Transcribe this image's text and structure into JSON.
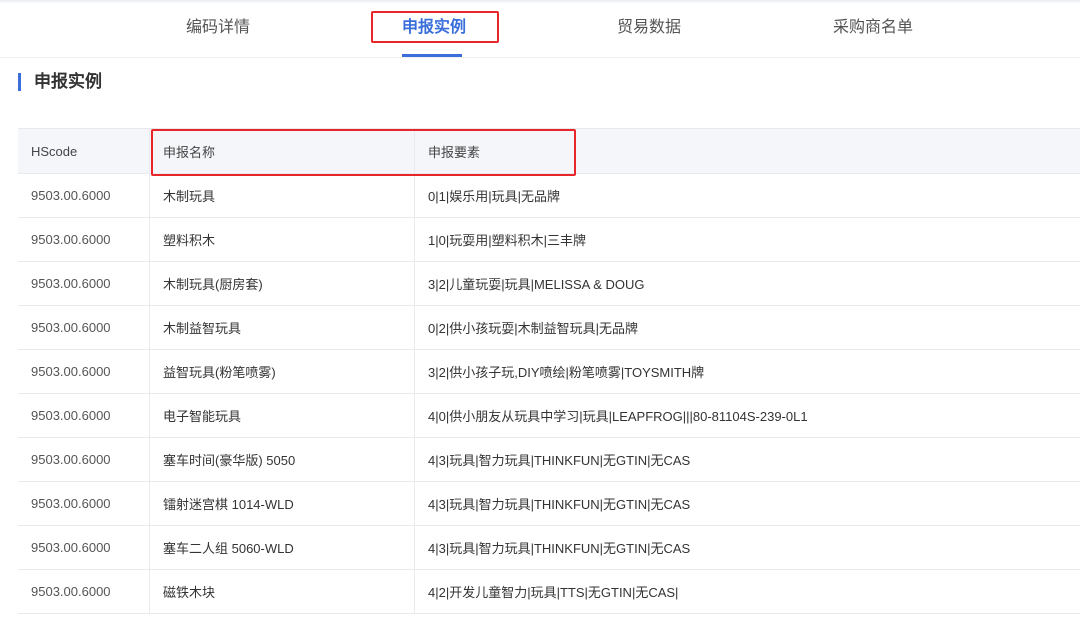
{
  "tabs": [
    {
      "label": "编码详情",
      "active": false
    },
    {
      "label": "申报实例",
      "active": true
    },
    {
      "label": "贸易数据",
      "active": false
    },
    {
      "label": "采购商名单",
      "active": false
    }
  ],
  "section": {
    "title": "申报实例"
  },
  "table": {
    "headers": [
      "HScode",
      "申报名称",
      "申报要素"
    ],
    "rows": [
      [
        "9503.00.6000",
        "木制玩具",
        "0|1|娱乐用|玩具|无品牌"
      ],
      [
        "9503.00.6000",
        "塑料积木",
        "1|0|玩耍用|塑料积木|三丰牌"
      ],
      [
        "9503.00.6000",
        "木制玩具(厨房套)",
        "3|2|儿童玩耍|玩具|MELISSA & DOUG"
      ],
      [
        "9503.00.6000",
        "木制益智玩具",
        "0|2|供小孩玩耍|木制益智玩具|无品牌"
      ],
      [
        "9503.00.6000",
        "益智玩具(粉笔喷雾)",
        "3|2|供小孩子玩,DIY喷绘|粉笔喷雾|TOYSMITH牌"
      ],
      [
        "9503.00.6000",
        "电子智能玩具",
        "4|0|供小朋友从玩具中学习|玩具|LEAPFROG|||80-81104S-239-0L1"
      ],
      [
        "9503.00.6000",
        "塞车时间(豪华版) 5050",
        "4|3|玩具|智力玩具|THINKFUN|无GTIN|无CAS"
      ],
      [
        "9503.00.6000",
        "镭射迷宫棋 1014-WLD",
        "4|3|玩具|智力玩具|THINKFUN|无GTIN|无CAS"
      ],
      [
        "9503.00.6000",
        "塞车二人组 5060-WLD",
        "4|3|玩具|智力玩具|THINKFUN|无GTIN|无CAS"
      ],
      [
        "9503.00.6000",
        "磁铁木块",
        "4|2|开发儿童智力|玩具|TTS|无GTIN|无CAS|"
      ]
    ]
  },
  "colors": {
    "accent": "#3a6fdb",
    "highlight": "#e8262a",
    "header_bg": "#f4f6fa"
  }
}
